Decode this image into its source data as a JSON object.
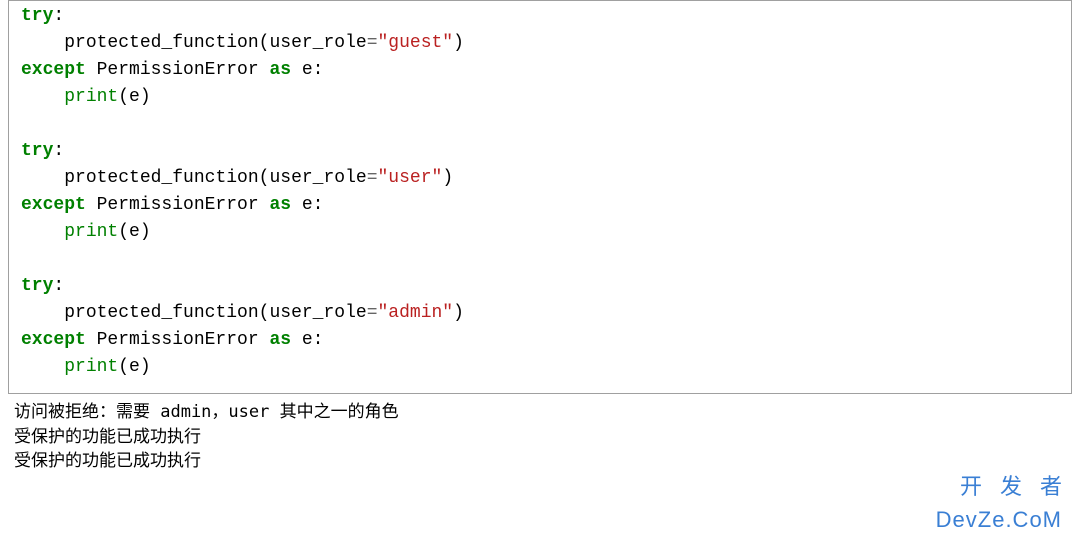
{
  "code": {
    "blocks": [
      {
        "try_kw": "try",
        "colon": ":",
        "indent": "    ",
        "fn": "protected_function",
        "lparen": "(",
        "arg_name": "user_role",
        "eq": "=",
        "arg_val": "\"guest\"",
        "rparen": ")",
        "except_kw": "except",
        "exc_name": " PermissionError ",
        "as_kw": "as",
        "var": " e",
        "colon2": ":",
        "print_fn": "print",
        "print_arg": "e"
      },
      {
        "try_kw": "try",
        "colon": ":",
        "indent": "    ",
        "fn": "protected_function",
        "lparen": "(",
        "arg_name": "user_role",
        "eq": "=",
        "arg_val": "\"user\"",
        "rparen": ")",
        "except_kw": "except",
        "exc_name": " PermissionError ",
        "as_kw": "as",
        "var": " e",
        "colon2": ":",
        "print_fn": "print",
        "print_arg": "e"
      },
      {
        "try_kw": "try",
        "colon": ":",
        "indent": "    ",
        "fn": "protected_function",
        "lparen": "(",
        "arg_name": "user_role",
        "eq": "=",
        "arg_val": "\"admin\"",
        "rparen": ")",
        "except_kw": "except",
        "exc_name": " PermissionError ",
        "as_kw": "as",
        "var": " e",
        "colon2": ":",
        "print_fn": "print",
        "print_arg": "e"
      }
    ]
  },
  "output": {
    "lines": [
      "访问被拒绝：需要 admin，user 其中之一的角色",
      "受保护的功能已成功执行",
      "受保护的功能已成功执行"
    ]
  },
  "watermark": {
    "top": "开发者",
    "bottom": "DevZe.CoM"
  }
}
